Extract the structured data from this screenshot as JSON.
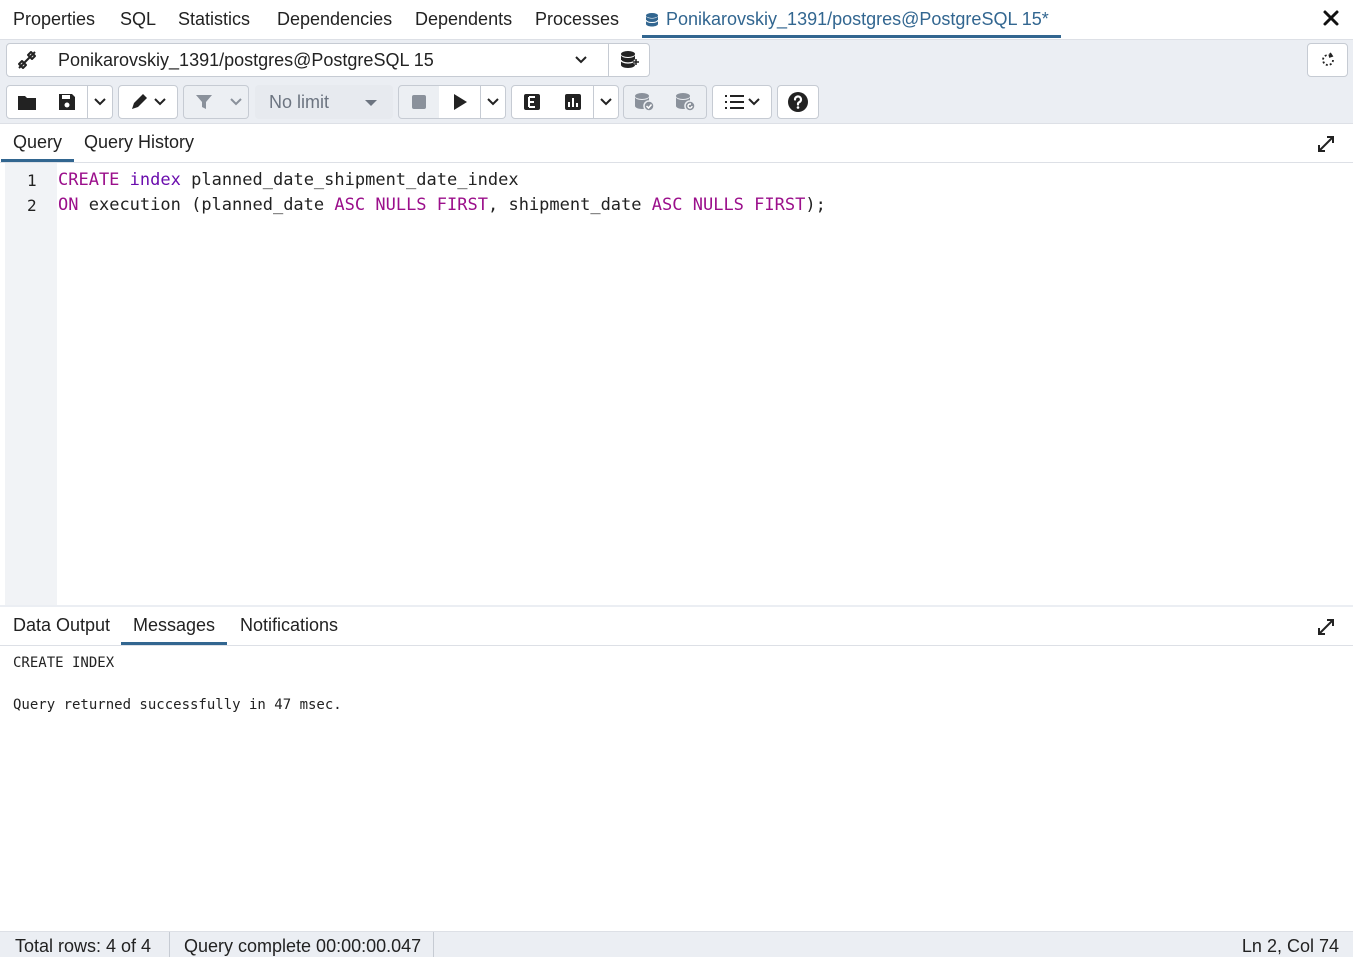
{
  "top_tabs": [
    "Properties",
    "SQL",
    "Statistics",
    "Dependencies",
    "Dependents",
    "Processes"
  ],
  "active_tab": "Ponikarovskiy_1391/postgres@PostgreSQL 15*",
  "connection": "Ponikarovskiy_1391/postgres@PostgreSQL 15",
  "limit": "No limit",
  "query_tabs": [
    "Query",
    "Query History"
  ],
  "editor": {
    "line_numbers": [
      "1",
      "2"
    ],
    "line1": {
      "kw1": "CREATE",
      "kw2": "index",
      "rest": "planned_date_shipment_date_index"
    },
    "line2": {
      "kw1": "ON",
      "t1": "execution (planned_date",
      "kw2": "ASC",
      "kw3": "NULLS",
      "kw4": "FIRST",
      "t2": ", shipment_date",
      "kw5": "ASC",
      "kw6": "NULLS",
      "kw7": "FIRST",
      "t3": ");"
    }
  },
  "result_tabs": [
    "Data Output",
    "Messages",
    "Notifications"
  ],
  "messages": [
    "CREATE INDEX",
    "Query returned successfully in 47 msec."
  ],
  "status": {
    "rows": "Total rows: 4 of 4",
    "query": "Query complete 00:00:00.047",
    "cursor": "Ln 2, Col 74"
  },
  "colors": {
    "accent": "#326690",
    "keyword": "#9b0f8b"
  }
}
